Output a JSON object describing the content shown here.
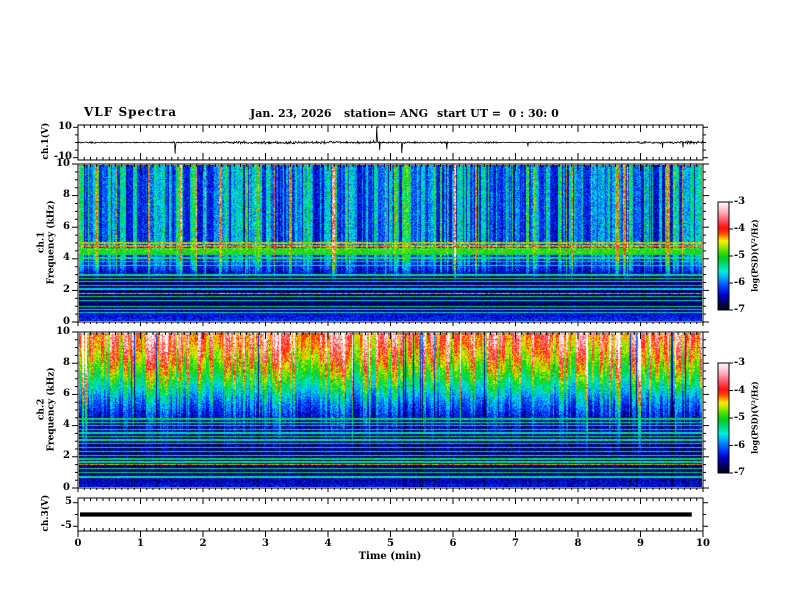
{
  "header": {
    "title": "VLF Spectra",
    "date": "Jan. 23, 2026",
    "station": "station= ANG",
    "start_ut": "start UT =  0 : 30: 0"
  },
  "time_axis": {
    "label": "Time (min)",
    "ticks": [
      0,
      1,
      2,
      3,
      4,
      5,
      6,
      7,
      8,
      9,
      10
    ],
    "minor_step": 0.1,
    "range": [
      0,
      10
    ]
  },
  "colorbar": {
    "label": "log(PSD)(V²/Hz)",
    "ticks": [
      -3,
      -4,
      -5,
      -6,
      -7
    ],
    "range": [
      -7,
      -3
    ]
  },
  "colormap_stops": [
    [
      0.0,
      "#000018"
    ],
    [
      0.06,
      "#000055"
    ],
    [
      0.14,
      "#0000cc"
    ],
    [
      0.22,
      "#0044ff"
    ],
    [
      0.3,
      "#00aaff"
    ],
    [
      0.36,
      "#00eedd"
    ],
    [
      0.42,
      "#00dd77"
    ],
    [
      0.48,
      "#00cc22"
    ],
    [
      0.54,
      "#44dd00"
    ],
    [
      0.6,
      "#bbee00"
    ],
    [
      0.64,
      "#ffee00"
    ],
    [
      0.675,
      "#ff9900"
    ],
    [
      0.71,
      "#ff4400"
    ],
    [
      0.76,
      "#ff0f0f"
    ],
    [
      0.83,
      "#ff5566"
    ],
    [
      0.9,
      "#ffaab4"
    ],
    [
      0.96,
      "#ffdde2"
    ],
    [
      1.0,
      "#ffffff"
    ]
  ],
  "panels": {
    "ch1v": {
      "label": "ch.1(V)",
      "ytick_labels": [
        "10",
        "-10"
      ],
      "yticks": [
        10,
        -10
      ],
      "ylim": [
        -11.5,
        11.5
      ]
    },
    "spec1": {
      "label_lines": [
        "ch.1",
        "Frequency (kHz)"
      ],
      "yticks": [
        0,
        2,
        4,
        6,
        8,
        10
      ],
      "ylim": [
        0,
        10
      ]
    },
    "spec2": {
      "label_lines": [
        "ch.2",
        "Frequency (kHz)"
      ],
      "yticks": [
        0,
        2,
        4,
        6,
        8,
        10
      ],
      "ylim": [
        0,
        10
      ]
    },
    "ch3v": {
      "label": "ch.3(V)",
      "ytick_labels": [
        "5",
        "-5"
      ],
      "yticks": [
        5,
        -5
      ],
      "ylim": [
        -7,
        7
      ]
    }
  },
  "chart_data": [
    {
      "name": "ch1-voltage",
      "type": "line",
      "ylabel": "ch.1(V)",
      "xlim": [
        0,
        10
      ],
      "ylim": [
        -10,
        10
      ],
      "description": "noisy broadband voltage trace centered on 0 V with impulsive sferic spikes",
      "baseline_v": 0,
      "noise_amp_v": 0.7,
      "points": 1250,
      "seed": 4242,
      "spikes": [
        {
          "t": 1.55,
          "v": -7.5
        },
        {
          "t": 4.78,
          "v": 10.5
        },
        {
          "t": 4.83,
          "v": -5.0
        },
        {
          "t": 5.18,
          "v": -7.0
        },
        {
          "t": 5.9,
          "v": -4.5
        },
        {
          "t": 7.2,
          "v": -2.6
        },
        {
          "t": 9.35,
          "v": -3.6
        },
        {
          "t": 9.68,
          "v": -3.2
        }
      ]
    },
    {
      "name": "ch1-spectrogram",
      "type": "heatmap",
      "xlim": [
        0,
        10
      ],
      "ylim_khz": [
        0,
        10
      ],
      "clim_log_psd": [
        -7,
        -3
      ],
      "description": "mostly blue background, dense vertical sferic streaks above ~3 kHz, bright green/yellow transmitter lines near 4.3-5.0 kHz and many narrow lines below 3 kHz",
      "seed": 12345,
      "noise": 0.15,
      "base_profile": [
        [
          0,
          0.19
        ],
        [
          0.35,
          0.16
        ],
        [
          0.6,
          0.1
        ],
        [
          1.0,
          0.075
        ],
        [
          2.9,
          0.07
        ],
        [
          3.3,
          0.13
        ],
        [
          6.0,
          0.14
        ],
        [
          10,
          0.15
        ]
      ],
      "streak": {
        "ramp": [
          2.5,
          4.2,
          0.02,
          0.95
        ],
        "amp": 0.42,
        "pow": 1.6,
        "cont": 0.45,
        "strong_p": 0.05,
        "strong_amp": 0.62,
        "red_p": 0.012,
        "dark_p": 0
      },
      "horizontal_lines_khz_width_amp": [
        [
          5.0,
          0.1,
          0.62
        ],
        [
          4.82,
          0.1,
          0.7
        ],
        [
          4.62,
          0.14,
          0.55
        ],
        [
          4.45,
          0.2,
          0.52
        ],
        [
          4.28,
          0.12,
          0.48
        ],
        [
          4.05,
          0.1,
          0.42
        ],
        [
          3.82,
          0.08,
          0.45
        ],
        [
          3.55,
          0.08,
          0.38
        ],
        [
          2.95,
          0.08,
          0.42
        ],
        [
          2.72,
          0.08,
          0.48
        ],
        [
          2.52,
          0.08,
          0.4
        ],
        [
          2.28,
          0.08,
          0.44
        ],
        [
          2.05,
          0.08,
          0.36
        ],
        [
          1.78,
          0.07,
          0.66
        ],
        [
          1.55,
          0.07,
          0.44
        ],
        [
          1.32,
          0.07,
          0.4
        ],
        [
          0.95,
          0.08,
          0.46
        ],
        [
          0.72,
          0.07,
          0.4
        ],
        [
          0.52,
          0.07,
          0.36
        ]
      ]
    },
    {
      "name": "ch2-spectrogram",
      "type": "heatmap",
      "xlim": [
        0,
        10
      ],
      "ylim_khz": [
        0,
        10
      ],
      "clim_log_psd": [
        -7,
        -3
      ],
      "description": "intense green/yellow band 8-10 kHz with orange/red streaks fading to dark blue below ~5 kHz; many narrow horizontal lines below 4.5 kHz incl. bright yellow line near 1.45 kHz",
      "seed": 67890,
      "noise": 0.15,
      "base_profile": [
        [
          0,
          0.15
        ],
        [
          0.4,
          0.12
        ],
        [
          1.0,
          0.08
        ],
        [
          3.0,
          0.07
        ],
        [
          4.5,
          0.1
        ],
        [
          5.5,
          0.18
        ],
        [
          6.5,
          0.3
        ],
        [
          7.5,
          0.43
        ],
        [
          8.5,
          0.53
        ],
        [
          9.3,
          0.59
        ],
        [
          10,
          0.63
        ]
      ],
      "streak": {
        "ramp": [
          2.0,
          9.5,
          0.05,
          1.0
        ],
        "amp": 0.5,
        "pow": 1.3,
        "cont": 0.5,
        "strong_p": 0.06,
        "strong_amp": 0.45,
        "red_p": 0.014,
        "dark_p": 0.012
      },
      "horizontal_lines_khz_width_amp": [
        [
          4.42,
          0.08,
          0.46
        ],
        [
          4.2,
          0.08,
          0.42
        ],
        [
          3.98,
          0.08,
          0.5
        ],
        [
          3.75,
          0.08,
          0.44
        ],
        [
          3.5,
          0.08,
          0.4
        ],
        [
          3.28,
          0.08,
          0.46
        ],
        [
          3.05,
          0.08,
          0.42
        ],
        [
          2.82,
          0.08,
          0.46
        ],
        [
          2.55,
          0.08,
          0.4
        ],
        [
          2.3,
          0.08,
          0.44
        ],
        [
          2.05,
          0.08,
          0.4
        ],
        [
          1.82,
          0.08,
          0.46
        ],
        [
          1.62,
          0.08,
          0.42
        ],
        [
          1.45,
          0.08,
          0.68
        ],
        [
          1.2,
          0.08,
          0.42
        ],
        [
          0.92,
          0.08,
          0.46
        ],
        [
          0.65,
          0.07,
          0.4
        ]
      ]
    },
    {
      "name": "ch3-voltage",
      "type": "line",
      "ylabel": "ch.3(V)",
      "xlim": [
        0,
        10
      ],
      "ylim": [
        -5,
        5
      ],
      "description": "flat thick trace at constant 0 V ending near t=9.82 min",
      "constant_v": 0,
      "trace_end_t": 9.82,
      "line_thickness_v": 0.8
    }
  ]
}
